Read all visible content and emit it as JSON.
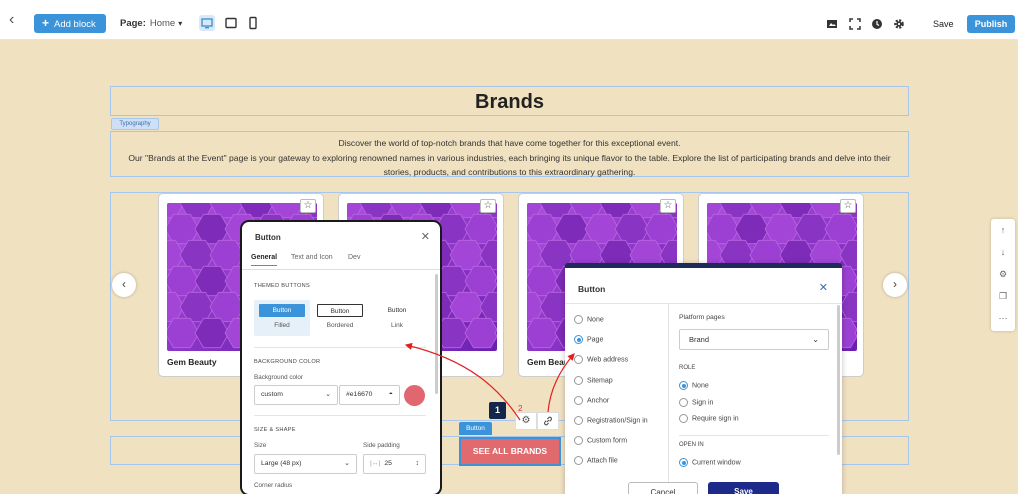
{
  "topbar": {
    "add_block_label": "Add block",
    "page_label": "Page:",
    "page_value": "Home",
    "save_label": "Save",
    "publish_label": "Publish"
  },
  "canvas": {
    "title": "Brands",
    "typography_tag": "Typography",
    "description_lines": [
      "Discover the world of top-notch brands that have come together for this exceptional event.",
      "Our \"Brands at the Event\" page is your gateway to exploring renowned names in various industries, each bringing its unique flavor to the table. Explore the list of participating brands and delve into their",
      "stories, products, and contributions to this extraordinary gathering."
    ],
    "cards": [
      {
        "name": "Gem Beauty"
      },
      {
        "name": ""
      },
      {
        "name": "Gem Beauty"
      },
      {
        "name": ""
      }
    ],
    "button_tag": "Button",
    "see_all_label": "SEE ALL BRANDS",
    "step_badge": "1",
    "step2": "2"
  },
  "panel_left": {
    "title": "Button",
    "tabs": [
      "General",
      "Text and Icon",
      "Dev"
    ],
    "active_tab": "General",
    "themed_heading": "THEMED BUTTONS",
    "themed_options": [
      {
        "sample": "Button",
        "caption": "Filled"
      },
      {
        "sample": "Button",
        "caption": "Bordered"
      },
      {
        "sample": "Button",
        "caption": "Link"
      }
    ],
    "bg_heading": "BACKGROUND COLOR",
    "bg_label": "Background color",
    "bg_mode": "custom",
    "bg_hex": "#e16670",
    "bg_swatch": "#e16670",
    "size_heading": "SIZE & SHAPE",
    "size_label": "Size",
    "size_value": "Large (48 px)",
    "padding_label": "Side padding",
    "padding_value": "25",
    "corner_label": "Corner radius"
  },
  "panel_right": {
    "title": "Button",
    "link_options": [
      "None",
      "Page",
      "Web address",
      "Sitemap",
      "Anchor",
      "Registration/Sign in",
      "Custom form",
      "Attach file"
    ],
    "selected_link": "Page",
    "platform_label": "Platform pages",
    "platform_value": "Brand",
    "role_heading": "ROLE",
    "role_options": [
      "None",
      "Sign in",
      "Require sign in"
    ],
    "selected_role": "None",
    "open_heading": "OPEN IN",
    "open_options": [
      "Current window"
    ],
    "selected_open": "Current window",
    "cancel_label": "Cancel",
    "save_label": "Save"
  },
  "colors": {
    "accent": "#3b94d9",
    "canvas_bg": "#f0e1c1",
    "button_red": "#e06a6e",
    "annotation_red": "#e02020",
    "save_navy": "#1e2a8a"
  }
}
